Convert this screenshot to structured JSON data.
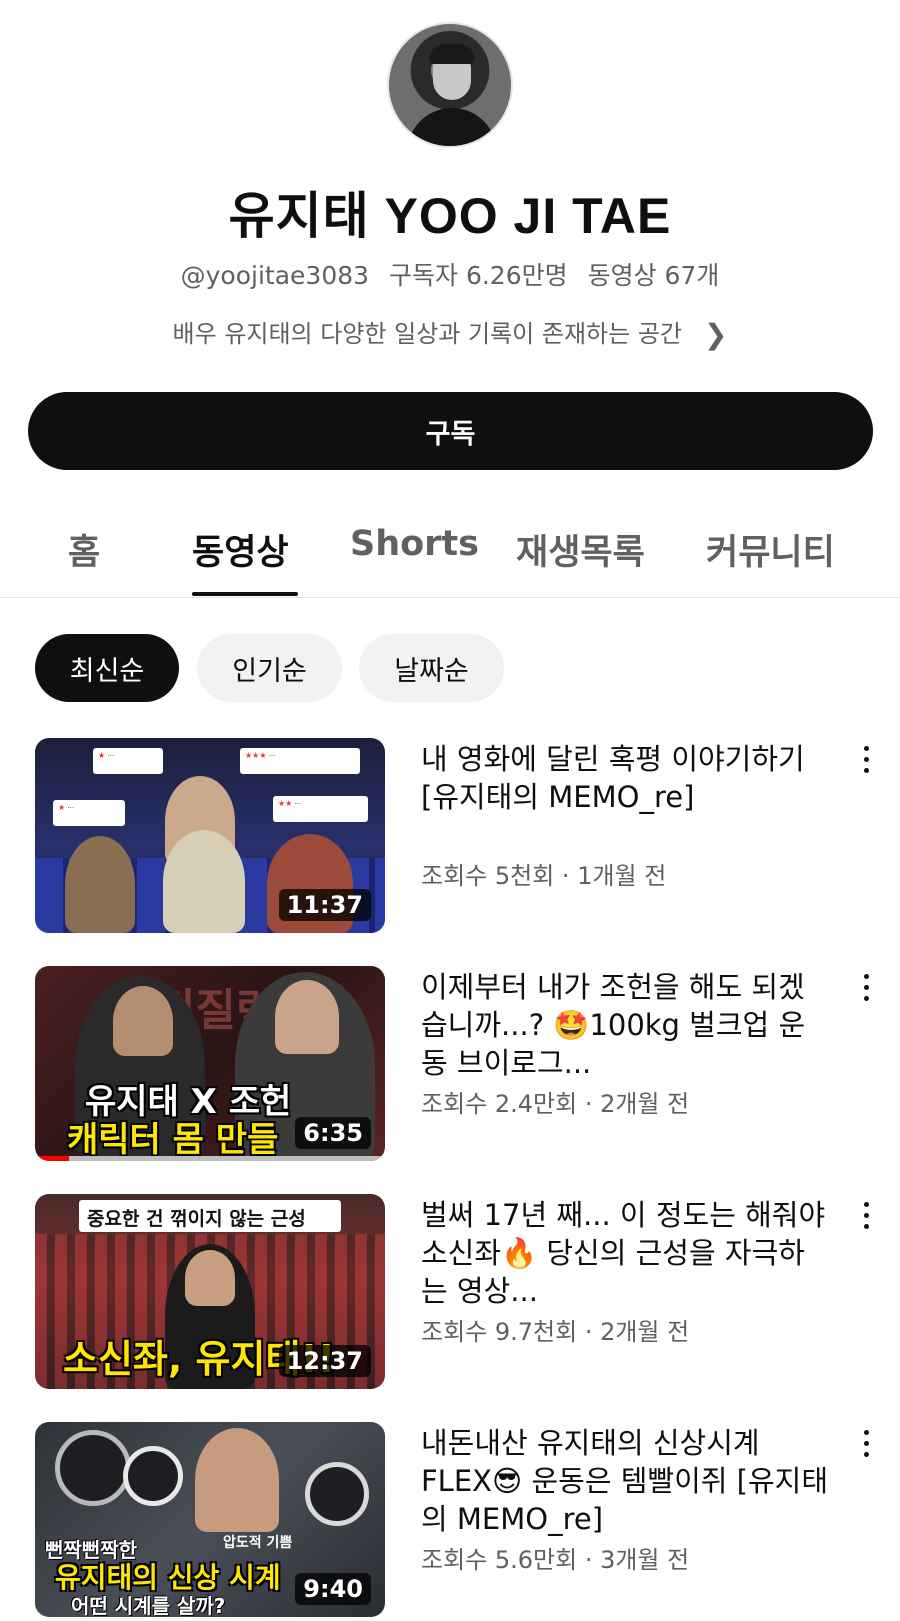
{
  "channel": {
    "name": "유지태 YOO JI TAE",
    "handle": "@yoojitae3083",
    "subscribers": "구독자 6.26만명",
    "video_count": "동영상 67개",
    "description": "배우 유지태의 다양한 일상과 기록이 존재하는 공간"
  },
  "subscribe_label": "구독",
  "tabs": [
    {
      "label": "홈"
    },
    {
      "label": "동영상"
    },
    {
      "label": "Shorts"
    },
    {
      "label": "재생목록"
    },
    {
      "label": "커뮤니티"
    }
  ],
  "active_tab": "동영상",
  "filters": [
    {
      "label": "최신순"
    },
    {
      "label": "인기순"
    },
    {
      "label": "날짜순"
    }
  ],
  "active_filter": "최신순",
  "videos": [
    {
      "title": "내 영화에 달린 혹평 이야기하기 [유지태의 MEMO_re]",
      "meta": "조회수 5천회 · 1개월 전",
      "duration": "11:37"
    },
    {
      "title": "이제부터 내가 조헌을 해도 되겠습니까...? 🤩100kg 벌크업 운동 브이로그...",
      "meta": "조회수 2.4만회 · 2개월 전",
      "duration": "6:35",
      "thumb_text": {
        "line1": "유지태 X 조헌",
        "line2": "캐릭터 몸 만들",
        "bg_text": "비질란테"
      }
    },
    {
      "title": "벌써 17년 째... 이 정도는 해줘야 소신좌🔥 당신의 근성을 자극하는 영상...",
      "meta": "조회수 9.7천회 · 2개월 전",
      "duration": "12:37",
      "thumb_text": {
        "banner": "중요한 건 꺾이지 않는 근성",
        "line1": "소신좌, 유지태!!"
      }
    },
    {
      "title": "내돈내산 유지태의 신상시계 FLEX😎 운동은 템빨이쥐 [유지태의 MEMO_re]",
      "meta": "조회수 5.6만회 · 3개월 전",
      "duration": "9:40",
      "thumb_text": {
        "line1": "뻔짝뻔짝한",
        "line2": "유지태의 신상 시계",
        "line3": "어떤 시계를 살까?",
        "tag": "압도적 기쁨"
      }
    }
  ],
  "colors": {
    "primary": "#0f0f0f",
    "secondary_text": "#606060",
    "chip_bg": "#f2f2f2",
    "thumb_yellow": "#ffe600"
  }
}
